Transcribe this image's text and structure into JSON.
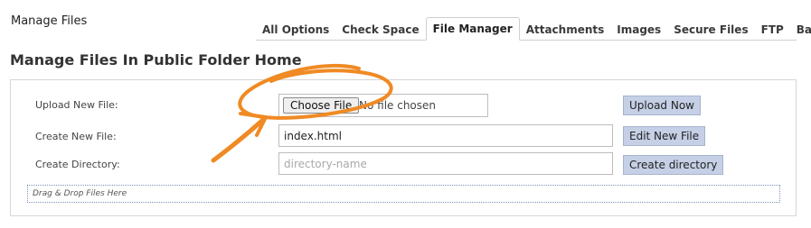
{
  "header": {
    "title": "Manage Files",
    "tabs": [
      {
        "label": "All Options"
      },
      {
        "label": "Check Space"
      },
      {
        "label": "File Manager",
        "active": true
      },
      {
        "label": "Attachments"
      },
      {
        "label": "Images"
      },
      {
        "label": "Secure Files"
      },
      {
        "label": "FTP"
      },
      {
        "label": "Backup"
      }
    ]
  },
  "main": {
    "heading": "Manage Files In Public Folder Home",
    "upload": {
      "label": "Upload New File:",
      "choose_label": "Choose File",
      "status": "No file chosen",
      "button_label": "Upload Now"
    },
    "create_file": {
      "label": "Create New File:",
      "value": "index.html",
      "button_label": "Edit New File"
    },
    "create_dir": {
      "label": "Create Directory:",
      "placeholder": "directory-name",
      "button_label": "Create directory"
    },
    "drop_zone": {
      "text": "Drag & Drop Files Here"
    }
  },
  "annotation": {
    "color": "#f08a24",
    "shape": "hand-drawn circle with arrow pointing to Choose File button"
  }
}
